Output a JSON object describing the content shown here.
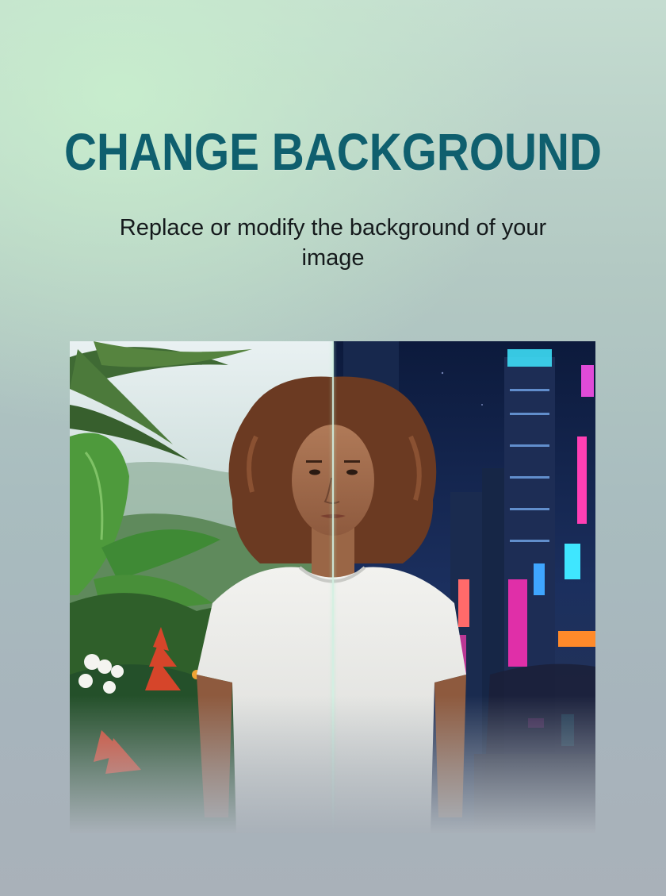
{
  "headline": "CHANGE BACKGROUND",
  "subtitle": "Replace or modify the background of your image",
  "comparison": {
    "left_scene": "tropical-jungle",
    "right_scene": "neon-city-night"
  },
  "colors": {
    "headline": "#0f5f6e",
    "subtitle": "#151a1c",
    "accent_neon_pink": "#ff3fb4",
    "accent_neon_cyan": "#3fe6ff"
  }
}
